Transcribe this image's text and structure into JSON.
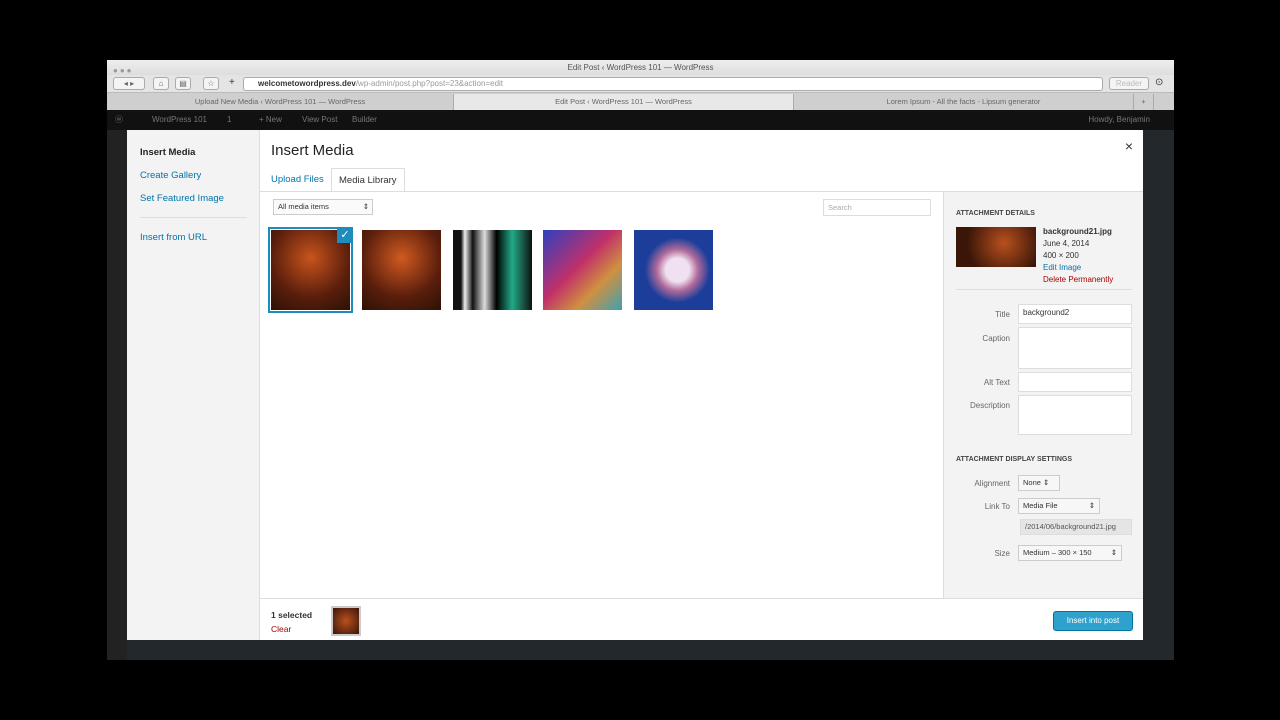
{
  "browser": {
    "title": "Edit Post ‹ WordPress 101 — WordPress",
    "url_domain": "welcometowordpress.dev",
    "url_path": "/wp-admin/post.php?post=23&action=edit",
    "reader": "Reader",
    "tabs": [
      "Upload New Media ‹ WordPress 101 — WordPress",
      "Edit Post ‹ WordPress 101 — WordPress",
      "Lorem Ipsum - All the facts - Lipsum generator"
    ]
  },
  "adminbar": {
    "site": "WordPress 101",
    "comments": "1",
    "new": "+ New",
    "view": "View Post",
    "builder": "Builder",
    "howdy": "Howdy, Benjamin"
  },
  "menu": {
    "items": [
      "Insert Media",
      "Create Gallery",
      "Set Featured Image",
      "Insert from URL"
    ]
  },
  "modal": {
    "title": "Insert Media",
    "close": "×",
    "tabs": [
      "Upload Files",
      "Media Library"
    ],
    "filter": "All media items",
    "search_placeholder": "Search",
    "check": "✓"
  },
  "details": {
    "heading": "Attachment Details",
    "filename": "background21.jpg",
    "date": "June 4, 2014",
    "dims": "400 × 200",
    "edit": "Edit Image",
    "delete": "Delete Permanently",
    "title_label": "Title",
    "title_value": "background2",
    "caption_label": "Caption",
    "alt_label": "Alt Text",
    "desc_label": "Description"
  },
  "display": {
    "heading": "Attachment Display Settings",
    "align_label": "Alignment",
    "align": "None",
    "link_label": "Link To",
    "link": "Media File",
    "link_url": "/2014/06/background21.jpg",
    "size_label": "Size",
    "size": "Medium – 300 × 150"
  },
  "footer": {
    "selected": "1 selected",
    "clear": "Clear",
    "insert": "Insert into post"
  }
}
